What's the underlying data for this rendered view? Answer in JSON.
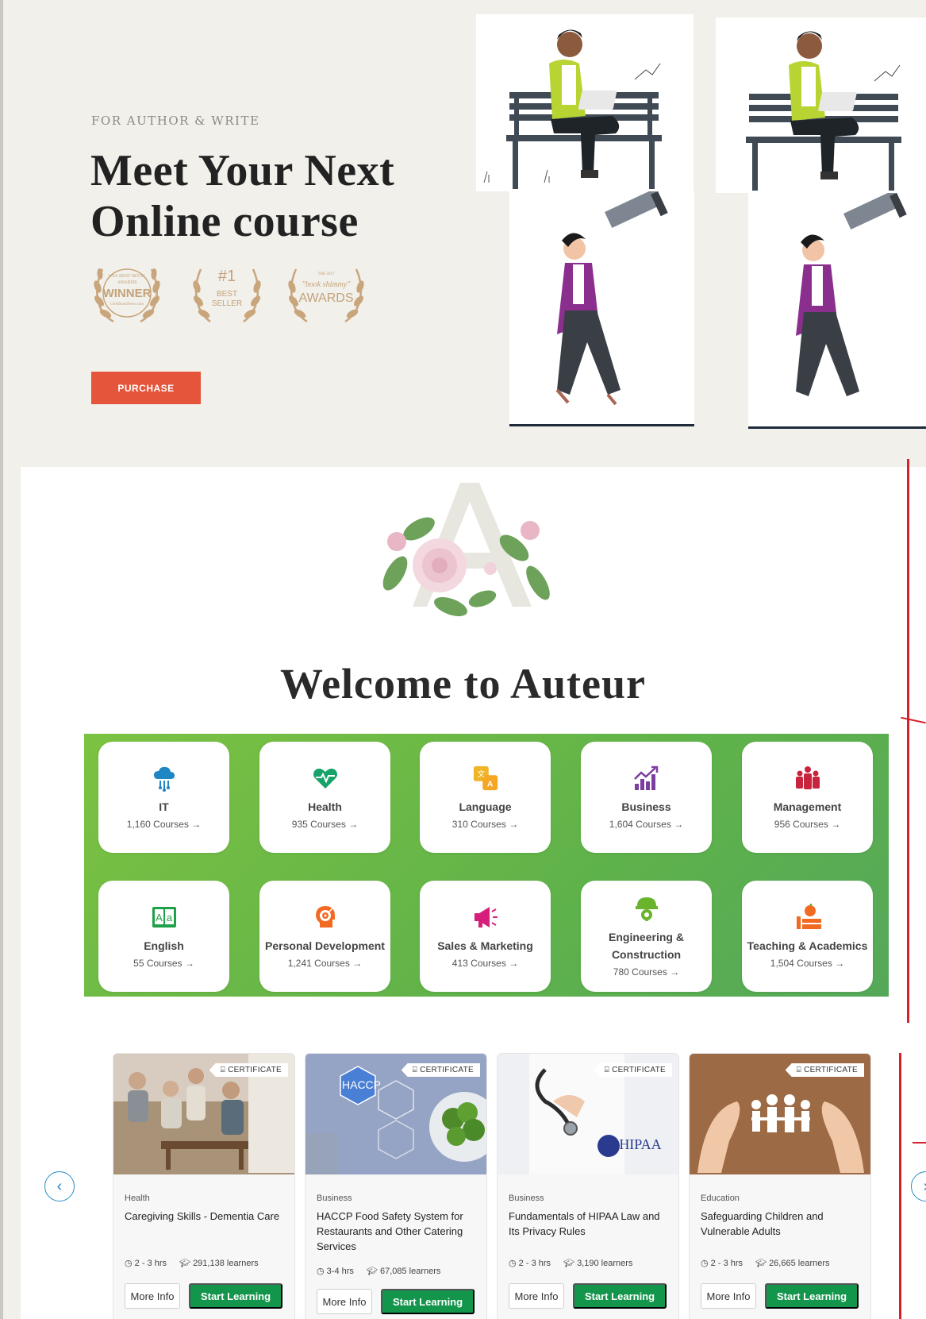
{
  "hero": {
    "eyebrow": "FOR AUTHOR & WRITE",
    "title_line1": "Meet Your Next",
    "title_line2": "Online course",
    "awards": [
      {
        "line1": "USA BEST BOOK",
        "line2": "AWARDS",
        "line3": "WINNER",
        "line4": "USABookNews.com"
      },
      {
        "line1": "#1",
        "line2": "BEST",
        "line3": "SELLER",
        "line4": ""
      },
      {
        "line1": "THE 2017",
        "line2": "\"book shimmy\"",
        "line3": "AWARDS",
        "line4": ""
      }
    ],
    "purchase_label": "PURCHASE"
  },
  "welcome": {
    "title": "Welcome to Auteur",
    "monogram_letter": "A"
  },
  "categories": [
    {
      "name": "IT",
      "count": "1,160 Courses",
      "icon": "cloud-network-icon",
      "color": "#1e86c4"
    },
    {
      "name": "Health",
      "count": "935 Courses",
      "icon": "heart-pulse-icon",
      "color": "#16a36a"
    },
    {
      "name": "Language",
      "count": "310 Courses",
      "icon": "translate-icon",
      "color": "#f0b429"
    },
    {
      "name": "Business",
      "count": "1,604 Courses",
      "icon": "growth-chart-icon",
      "color": "#7b3fa0"
    },
    {
      "name": "Management",
      "count": "956 Courses",
      "icon": "team-icon",
      "color": "#c8243d"
    },
    {
      "name": "English",
      "count": "55 Courses",
      "icon": "alphabet-book-icon",
      "color": "#1fa04a"
    },
    {
      "name": "Personal Development",
      "count": "1,241 Courses",
      "icon": "target-head-icon",
      "color": "#f26a21"
    },
    {
      "name": "Sales & Marketing",
      "count": "413 Courses",
      "icon": "megaphone-icon",
      "color": "#d61f7c"
    },
    {
      "name": "Engineering & Construction",
      "count": "780 Courses",
      "icon": "hard-hat-gear-icon",
      "color": "#6ab42d"
    },
    {
      "name": "Teaching & Academics",
      "count": "1,504 Courses",
      "icon": "apple-books-icon",
      "color": "#f26a21"
    }
  ],
  "arrow_glyph": "→",
  "carousel": {
    "prev_glyph": "‹",
    "next_glyph": "›"
  },
  "courses": [
    {
      "category": "Health",
      "title": "Caregiving Skills - Dementia Care",
      "duration": "2 - 3 hrs",
      "learners": "291,138 learners",
      "badge": "CERTIFICATE",
      "more": "More Info",
      "start": "Start Learning"
    },
    {
      "category": "Business",
      "title": "HACCP Food Safety System for Restaurants and Other Catering Services",
      "duration": "3-4 hrs",
      "learners": "67,085 learners",
      "badge": "CERTIFICATE",
      "more": "More Info",
      "start": "Start Learning",
      "image_text": "HACCP"
    },
    {
      "category": "Business",
      "title": "Fundamentals of HIPAA Law and Its Privacy Rules",
      "duration": "2 - 3 hrs",
      "learners": "3,190 learners",
      "badge": "CERTIFICATE",
      "more": "More Info",
      "start": "Start Learning",
      "image_text": "HIPAA"
    },
    {
      "category": "Education",
      "title": "Safeguarding Children and Vulnerable Adults",
      "duration": "2 - 3 hrs",
      "learners": "26,665 learners",
      "badge": "CERTIFICATE",
      "more": "More Info",
      "start": "Start Learning"
    }
  ],
  "colors": {
    "accent_red": "#e4553b",
    "green_button": "#14954c",
    "green_panel": "#6cb944",
    "carousel_blue": "#2a8bc8"
  }
}
